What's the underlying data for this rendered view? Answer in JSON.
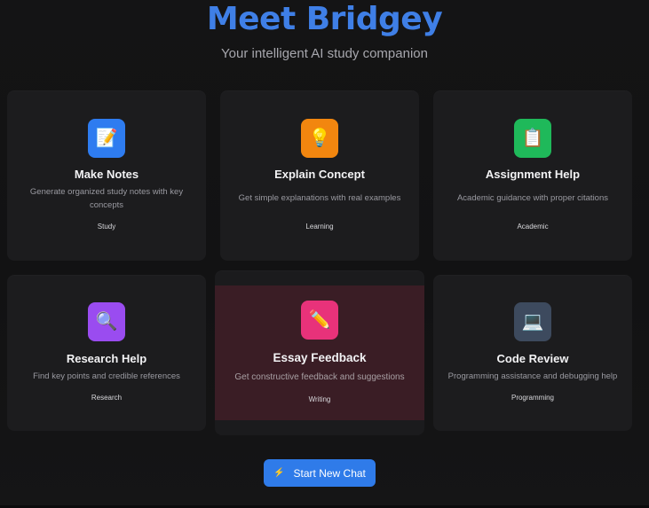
{
  "hero": {
    "title": "Meet Bridgey",
    "subtitle": "Your intelligent AI study companion"
  },
  "cards": [
    {
      "title": "Make Notes",
      "description": "Generate organized study notes with key concepts",
      "tag": "Study",
      "icon": "notes-icon",
      "icon_glyph": "📝",
      "color": "#2e7cf0"
    },
    {
      "title": "Explain Concept",
      "description": "Get simple explanations with real examples",
      "tag": "Learning",
      "icon": "lightbulb-icon",
      "icon_glyph": "💡",
      "color": "#f2860f"
    },
    {
      "title": "Assignment Help",
      "description": "Academic guidance with proper citations",
      "tag": "Academic",
      "icon": "clipboard-icon",
      "icon_glyph": "📋",
      "color": "#1fb95a"
    },
    {
      "title": "Research Help",
      "description": "Find key points and credible references",
      "tag": "Research",
      "icon": "magnifier-icon",
      "icon_glyph": "🔍",
      "color": "#9a4cf0"
    },
    {
      "title": "Essay Feedback",
      "description": "Get constructive feedback and suggestions",
      "tag": "Writing",
      "icon": "pencil-icon",
      "icon_glyph": "✏️",
      "color": "#e8327a"
    },
    {
      "title": "Code Review",
      "description": "Programming assistance and debugging help",
      "tag": "Programming",
      "icon": "laptop-icon",
      "icon_glyph": "💻",
      "color": "#3d4a5e"
    }
  ],
  "cta": {
    "label": "Start New Chat",
    "icon": "bolt-icon",
    "icon_glyph": "⚡"
  }
}
